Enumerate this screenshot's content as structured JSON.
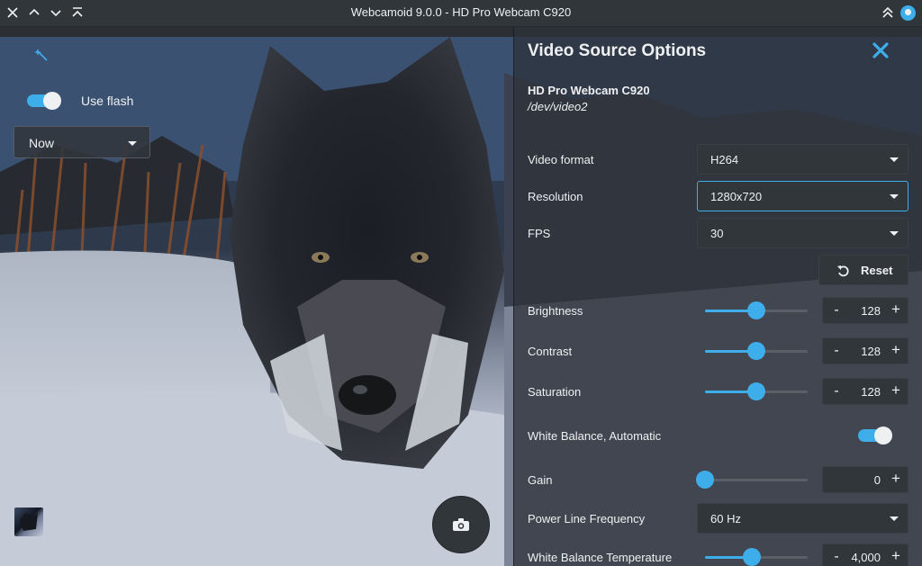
{
  "window": {
    "title": "Webcamoid 9.0.0 - HD Pro Webcam C920"
  },
  "titlebar_icons": [
    "close-icon",
    "chevron-up-icon",
    "chevron-down-icon",
    "keep-above-icon",
    "keep-above-right-icon",
    "app-icon"
  ],
  "preview": {
    "flash": {
      "label": "Use flash",
      "on": true
    },
    "timer": {
      "value": "Now"
    },
    "icons": [
      "magic-wand-icon",
      "camera-icon",
      "thumbnail"
    ]
  },
  "panel": {
    "title": "Video Source Options",
    "device_name": "HD Pro Webcam C920",
    "device_path": "/dev/video2",
    "video_format": {
      "label": "Video format",
      "value": "H264"
    },
    "resolution": {
      "label": "Resolution",
      "value": "1280x720"
    },
    "fps": {
      "label": "FPS",
      "value": "30"
    },
    "reset_label": "Reset",
    "brightness": {
      "label": "Brightness",
      "value": "128",
      "level": 0.5
    },
    "contrast": {
      "label": "Contrast",
      "value": "128",
      "level": 0.5
    },
    "saturation": {
      "label": "Saturation",
      "value": "128",
      "level": 0.5
    },
    "white_balance_auto": {
      "label": "White Balance, Automatic",
      "on": true
    },
    "gain": {
      "label": "Gain",
      "value": "0",
      "level": 0.0
    },
    "power_line": {
      "label": "Power Line Frequency",
      "value": "60 Hz"
    },
    "wb_temperature": {
      "label": "White Balance Temperature",
      "value": "4,000",
      "level": 0.46
    },
    "spin_minus": "-",
    "spin_plus": "+"
  },
  "colors": {
    "accent": "#3daee9",
    "background": "#31363b",
    "text": "#eff0f1"
  }
}
